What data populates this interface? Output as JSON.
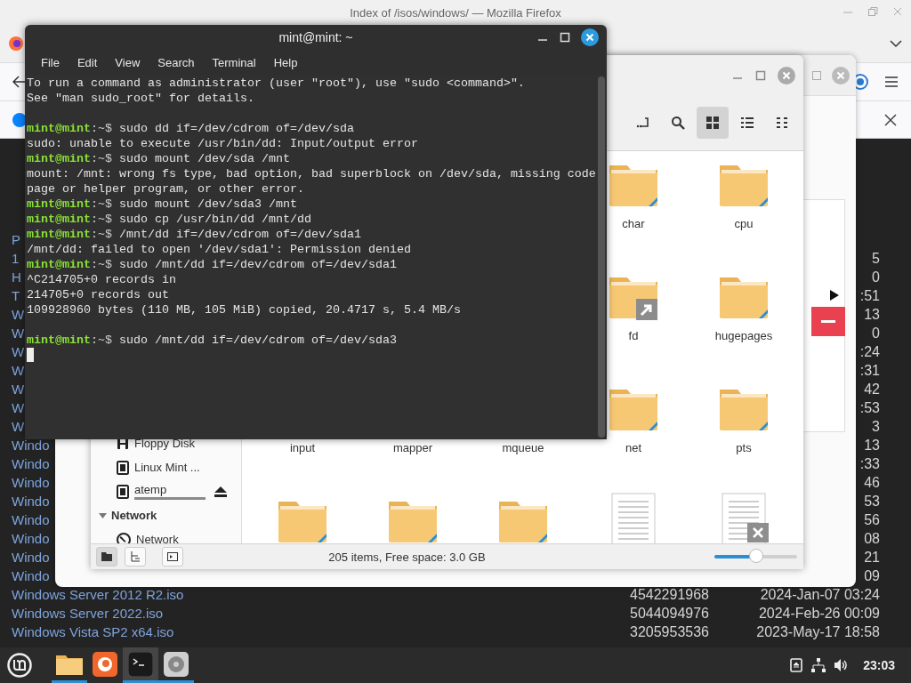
{
  "firefox": {
    "title": "Index of /isos/windows/ — Mozilla Firefox",
    "listing": [
      {
        "name": "P"
      },
      {
        "name": "1",
        "date": "5"
      },
      {
        "name": "H",
        "date": "0"
      },
      {
        "name": "T",
        "date": ":51"
      },
      {
        "name": "W",
        "date": "13"
      },
      {
        "name": "W",
        "date": "0"
      },
      {
        "name": "W",
        "date": ":24"
      },
      {
        "name": "W",
        "date": ":31"
      },
      {
        "name": "W",
        "date": "42"
      },
      {
        "name": "W",
        "date": ":53"
      },
      {
        "name": "W",
        "date": "3"
      },
      {
        "name": "Windo",
        "date": "13"
      },
      {
        "name": "Windo",
        "date": ":33"
      },
      {
        "name": "Windo",
        "date": "46"
      },
      {
        "name": "Windo",
        "date": "53"
      },
      {
        "name": "Windo",
        "date": "56"
      },
      {
        "name": "Windo",
        "date": "08"
      },
      {
        "name": "Windo",
        "date": "21"
      },
      {
        "name": "Windo",
        "date": "09"
      },
      {
        "name": "Windows Server 2012 R2.iso",
        "size": "4542291968",
        "date": "2024-Jan-07 03:24"
      },
      {
        "name": "Windows Server 2022.iso",
        "size": "5044094976",
        "date": "2024-Feb-26 00:09"
      },
      {
        "name": "Windows Vista SP2 x64.iso",
        "size": "3205953536",
        "date": "2023-May-17 18:58"
      }
    ]
  },
  "file_manager": {
    "tools": [
      {
        "kind": "path-toggle"
      },
      {
        "kind": "search"
      }
    ],
    "views": [
      {
        "kind": "grid",
        "selected": true
      },
      {
        "kind": "list",
        "selected": false
      },
      {
        "kind": "compact",
        "selected": false
      }
    ],
    "sidebar": [
      {
        "kind": "floppy",
        "name": "Floppy Disk",
        "eject": false
      },
      {
        "kind": "drive",
        "name": "Linux Mint ...",
        "eject": false
      },
      {
        "kind": "drive",
        "name": "atemp",
        "eject": true,
        "level": 1
      },
      {
        "kind": "header",
        "name": "Network",
        "expanded": true
      },
      {
        "kind": "network",
        "name": "Network",
        "eject": false
      }
    ],
    "rows": [
      {
        "items": [
          {
            "name": "char",
            "kind": "folder",
            "link": false
          },
          {
            "name": "cpu",
            "kind": "folder",
            "link": false
          }
        ]
      },
      {
        "items": [
          {
            "name": "fd",
            "kind": "folder",
            "link": true
          },
          {
            "name": "hugepages",
            "kind": "folder",
            "link": false
          }
        ]
      },
      {
        "items": [
          {
            "name": "input"
          },
          {
            "name": "mapper"
          },
          {
            "name": "mqueue"
          },
          {
            "name": "net",
            "kind": "folder",
            "link": false
          },
          {
            "name": "pts",
            "kind": "folder",
            "link": false
          }
        ]
      },
      {
        "items": [
          {
            "kind": "folder",
            "link": false
          },
          {
            "kind": "folder",
            "link": false
          },
          {
            "kind": "folder",
            "link": false
          },
          {
            "kind": "document"
          },
          {
            "kind": "document"
          }
        ]
      }
    ],
    "panes": [
      {
        "kind": "places",
        "selected": true
      },
      {
        "kind": "tree",
        "selected": false
      }
    ],
    "status": "205 items, Free space: 3.0 GB",
    "zoom": {
      "level": 0.5
    }
  },
  "terminal": {
    "title": "mint@mint: ~",
    "menu": [
      "File",
      "Edit",
      "View",
      "Search",
      "Terminal",
      "Help"
    ],
    "lines": [
      {
        "kind": "output",
        "text": "To run a command as administrator (user \"root\"), use \"sudo <command>\"."
      },
      {
        "kind": "output",
        "text": "See \"man sudo_root\" for details."
      },
      {
        "kind": "blank"
      },
      {
        "kind": "prompt",
        "user": "mint@mint",
        "path": ":~$",
        "command": "sudo dd if=/dev/cdrom of=/dev/sda"
      },
      {
        "kind": "output",
        "text": "sudo: unable to execute /usr/bin/dd: Input/output error"
      },
      {
        "kind": "prompt",
        "user": "mint@mint",
        "path": ":~$",
        "command": "sudo mount /dev/sda /mnt"
      },
      {
        "kind": "output",
        "text": "mount: /mnt: wrong fs type, bad option, bad superblock on /dev/sda, missing code"
      },
      {
        "kind": "output",
        "text": "page or helper program, or other error."
      },
      {
        "kind": "prompt",
        "user": "mint@mint",
        "path": ":~$",
        "command": "sudo mount /dev/sda3 /mnt"
      },
      {
        "kind": "prompt",
        "user": "mint@mint",
        "path": ":~$",
        "command": "sudo cp /usr/bin/dd /mnt/dd"
      },
      {
        "kind": "prompt",
        "user": "mint@mint",
        "path": ":~$",
        "command": "/mnt/dd if=/dev/cdrom of=/dev/sda1"
      },
      {
        "kind": "output",
        "text": "/mnt/dd: failed to open '/dev/sda1': Permission denied"
      },
      {
        "kind": "prompt",
        "user": "mint@mint",
        "path": ":~$",
        "command": "sudo /mnt/dd if=/dev/cdrom of=/dev/sda1"
      },
      {
        "kind": "output",
        "text": "^C214705+0 records in"
      },
      {
        "kind": "output",
        "text": "214705+0 records out"
      },
      {
        "kind": "output",
        "text": "109928960 bytes (110 MB, 105 MiB) copied, 20.4717 s, 5.4 MB/s"
      },
      {
        "kind": "blank"
      },
      {
        "kind": "prompt",
        "user": "mint@mint",
        "path": ":~$",
        "command": "sudo /mnt/dd if=/dev/cdrom of=/dev/sda3"
      },
      {
        "kind": "cursor"
      }
    ]
  },
  "taskbar": {
    "apps": [
      {
        "kind": "files",
        "running": true,
        "selected": false
      },
      {
        "kind": "firefox",
        "running": false,
        "selected": false
      },
      {
        "kind": "terminal",
        "running": true,
        "selected": true
      },
      {
        "kind": "disks",
        "running": true,
        "selected": false
      }
    ],
    "clock": "23:03"
  }
}
